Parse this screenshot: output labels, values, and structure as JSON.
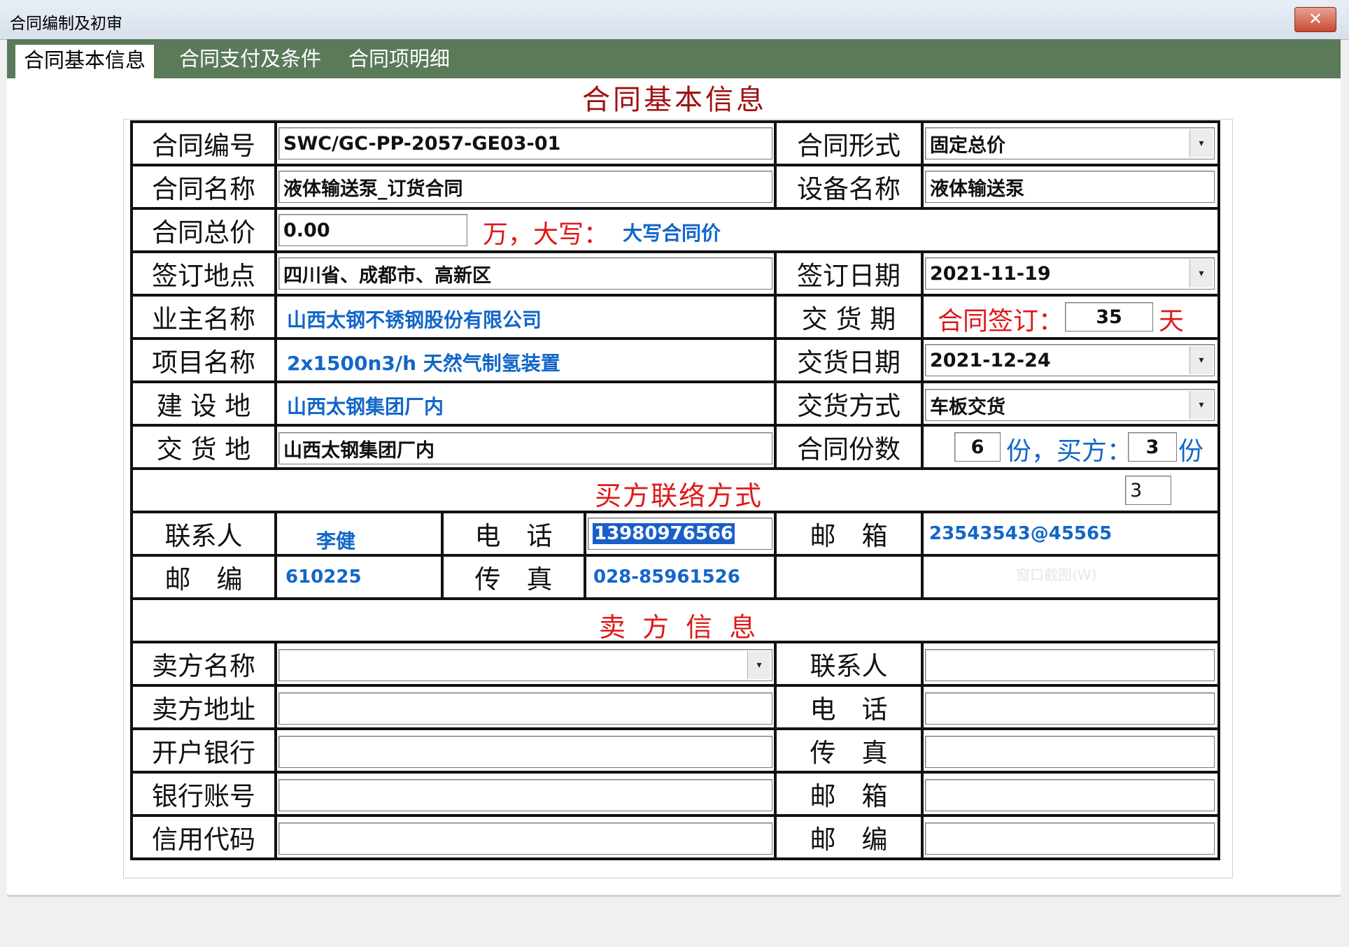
{
  "window": {
    "title": "合同编制及初审",
    "close": "✕"
  },
  "tabs": [
    "合同基本信息",
    "合同支付及条件",
    "合同项明细"
  ],
  "form_title": "合同基本信息",
  "rows": {
    "contract_no_label": "合同编号",
    "contract_no": "SWC/GC-PP-2057-GE03-01",
    "form_label": "合同形式",
    "form_value": "固定总价",
    "name_label": "合同名称",
    "name_value": "液体输送泵_订货合同",
    "equip_label": "设备名称",
    "equip_value": "液体输送泵",
    "total_label": "合同总价",
    "total_value": "0.00",
    "total_unit": "万，大写：",
    "total_upper": "大写合同价",
    "place_label": "签订地点",
    "place_value": "四川省、成都市、高新区",
    "date_label": "签订日期",
    "date_value": "2021-11-19",
    "owner_label": "业主名称",
    "owner_value": "山西太钢不锈钢股份有限公司",
    "period_label": "交 货 期",
    "period_prefix": "合同签订：",
    "period_days": "35",
    "period_unit": "天",
    "project_label": "项目名称",
    "project_value": "2x1500n3/h 天然气制氢装置",
    "delivery_date_label": "交货日期",
    "delivery_date": "2021-12-24",
    "site_label": "建 设 地",
    "site_value": "山西太钢集团厂内",
    "delivery_mode_label": "交货方式",
    "delivery_mode": "车板交货",
    "delivery_place_label": "交 货 地",
    "delivery_place": "山西太钢集团厂内",
    "copies_label": "合同份数",
    "copies_total": "6",
    "copies_unit1": "份，买方：",
    "copies_buyer": "3",
    "copies_unit2": "份"
  },
  "buyer": {
    "section_title": "买方联络方式",
    "section_value": "3",
    "contact_label": "联系人",
    "contact": "李健",
    "phone_label": "电　话",
    "phone": "13980976566",
    "email_label": "邮　箱",
    "email": "23543543@45565",
    "zip_label": "邮　编",
    "zip": "610225",
    "fax_label": "传　真",
    "fax": "028-85961526",
    "watermark": "窗口截图(W)"
  },
  "seller": {
    "section_title": "卖 方 信 息",
    "name_label": "卖方名称",
    "contact_label": "联系人",
    "addr_label": "卖方地址",
    "phone_label": "电　话",
    "bank_label": "开户银行",
    "fax_label": "传　真",
    "account_label": "银行账号",
    "email_label": "邮　箱",
    "credit_label": "信用代码",
    "zip_label": "邮　编"
  }
}
